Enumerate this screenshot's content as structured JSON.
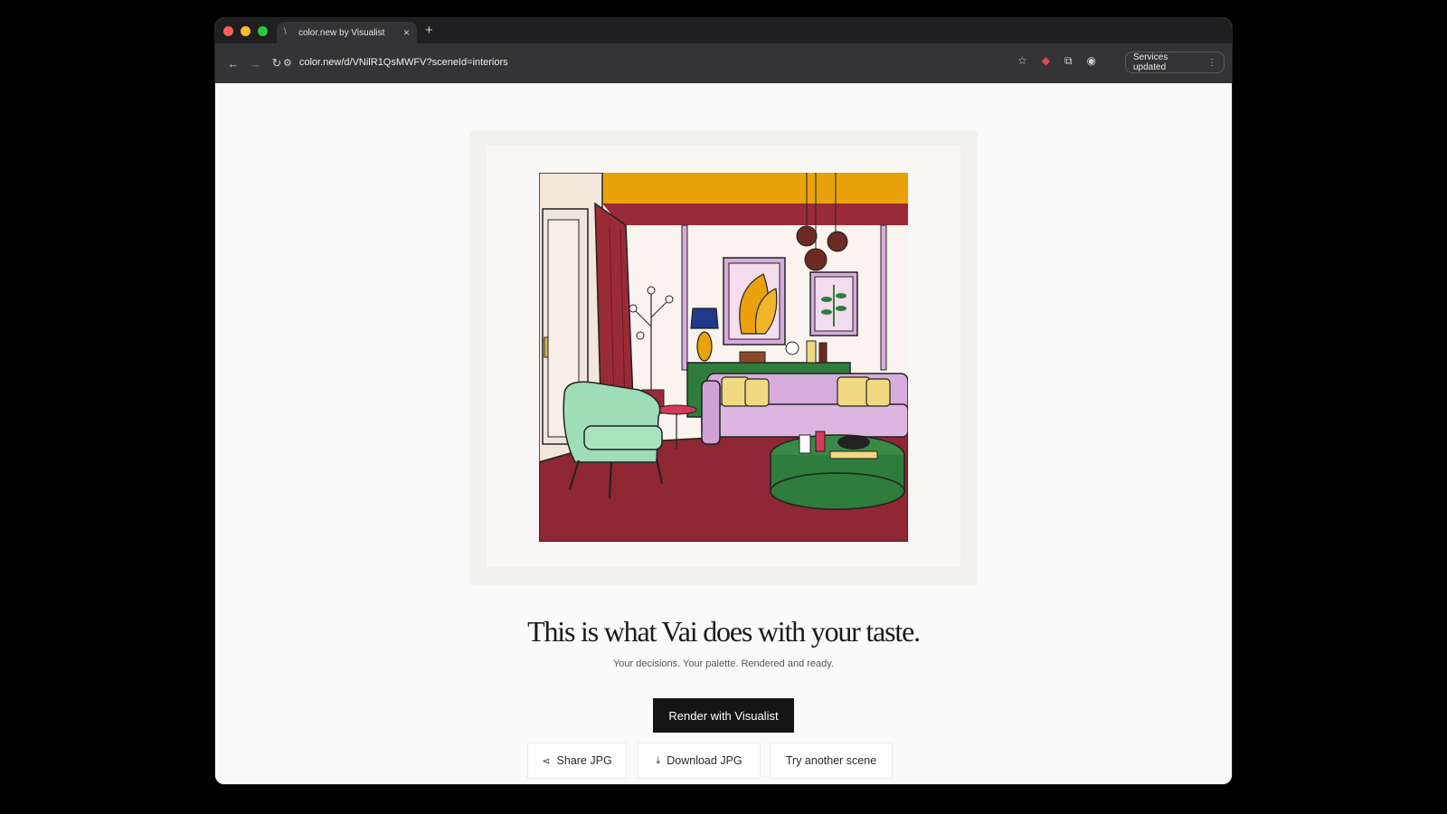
{
  "browser": {
    "tab_title": "color.new by Visualist",
    "url": "color.new/d/VNilR1QsMWFV?sceneId=interiors",
    "services_label": "Services updated"
  },
  "page": {
    "headline": "This is what Vai does with your taste.",
    "subline": "Your decisions. Your palette. Rendered and ready.",
    "primary_button": "Render with Visualist",
    "share_button": "Share JPG",
    "download_button": "Download JPG",
    "try_button": "Try another scene"
  },
  "icons": {
    "share": "share-icon",
    "download": "download-icon",
    "back": "back-arrow-icon",
    "forward": "forward-arrow-icon",
    "reload": "reload-icon",
    "bookmark": "star-icon",
    "extensions": "puzzle-icon",
    "profile": "profile-icon"
  },
  "palette": {
    "ceiling": "#e9a20c",
    "wall_red": "#9b2a38",
    "floor": "#8f2734",
    "lilac": "#d7acdc",
    "mint": "#9fdcb8",
    "green": "#2f7d3c",
    "yellow": "#f1d982",
    "navy": "#1f3a8a"
  }
}
